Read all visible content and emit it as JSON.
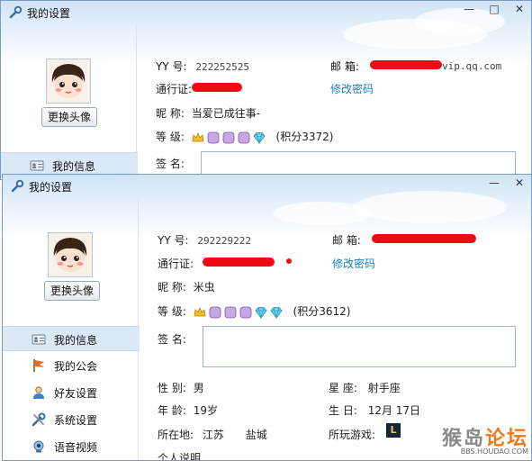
{
  "colors": {
    "link": "#1a7fb8",
    "redaction": "#ee0c14",
    "accent": "#f07a1a"
  },
  "window1": {
    "title": "我的设置",
    "controls": [
      "—",
      "□",
      "✕"
    ],
    "change_avatar": "更换头像",
    "nav_first": "我的信息",
    "fields": {
      "yy_label": "YY 号:",
      "yy_value": "222252525",
      "email_label": "邮 箱:",
      "email_suffix": "vip.qq.com",
      "pass_label": "通行证:",
      "change_pw": "修改密码",
      "nick_label": "昵 称:",
      "nick_value": "当爱已成往事-",
      "level_label": "等 级:",
      "level_icons": [
        "crown-icon",
        "moon-icon",
        "moon-icon",
        "moon-icon",
        "diamond-icon"
      ],
      "points": "(积分3372)",
      "sig_label": "签 名:"
    }
  },
  "window2": {
    "title": "我的设置",
    "controls": [
      "—",
      "✕"
    ],
    "change_avatar": "更换头像",
    "nav": [
      {
        "label": "我的信息",
        "icon": "id-card-icon",
        "active": true
      },
      {
        "label": "我的公会",
        "icon": "flag-icon",
        "active": false
      },
      {
        "label": "好友设置",
        "icon": "person-icon",
        "active": false
      },
      {
        "label": "系统设置",
        "icon": "tools-icon",
        "active": false
      },
      {
        "label": "语音视频",
        "icon": "camera-icon",
        "active": false
      }
    ],
    "fields": {
      "yy_label": "YY 号:",
      "yy_value": "292229222",
      "email_label": "邮 箱:",
      "pass_label": "通行证:",
      "change_pw": "修改密码",
      "nick_label": "昵 称:",
      "nick_value": "米虫",
      "level_label": "等 级:",
      "level_icons": [
        "crown-icon",
        "moon-icon",
        "moon-icon",
        "moon-icon",
        "diamond-icon",
        "diamond-icon"
      ],
      "points": "(积分3612)",
      "sig_label": "签 名:",
      "gender_label": "性 别:",
      "gender_value": "男",
      "constellation_label": "星 座:",
      "constellation_value": "射手座",
      "age_label": "年 龄:",
      "age_value": "19岁",
      "birthday_label": "生 日:",
      "birthday_value": "12月 17日",
      "location_label": "所在地:",
      "province": "江苏",
      "city": "盐城",
      "games_label": "所玩游戏:",
      "game_icon_text": "L",
      "partial_bottom": "个人说明"
    }
  },
  "watermark": {
    "main_a": "猴岛",
    "main_b": "论坛",
    "sub": "BBS.HOUDAO.COM"
  }
}
